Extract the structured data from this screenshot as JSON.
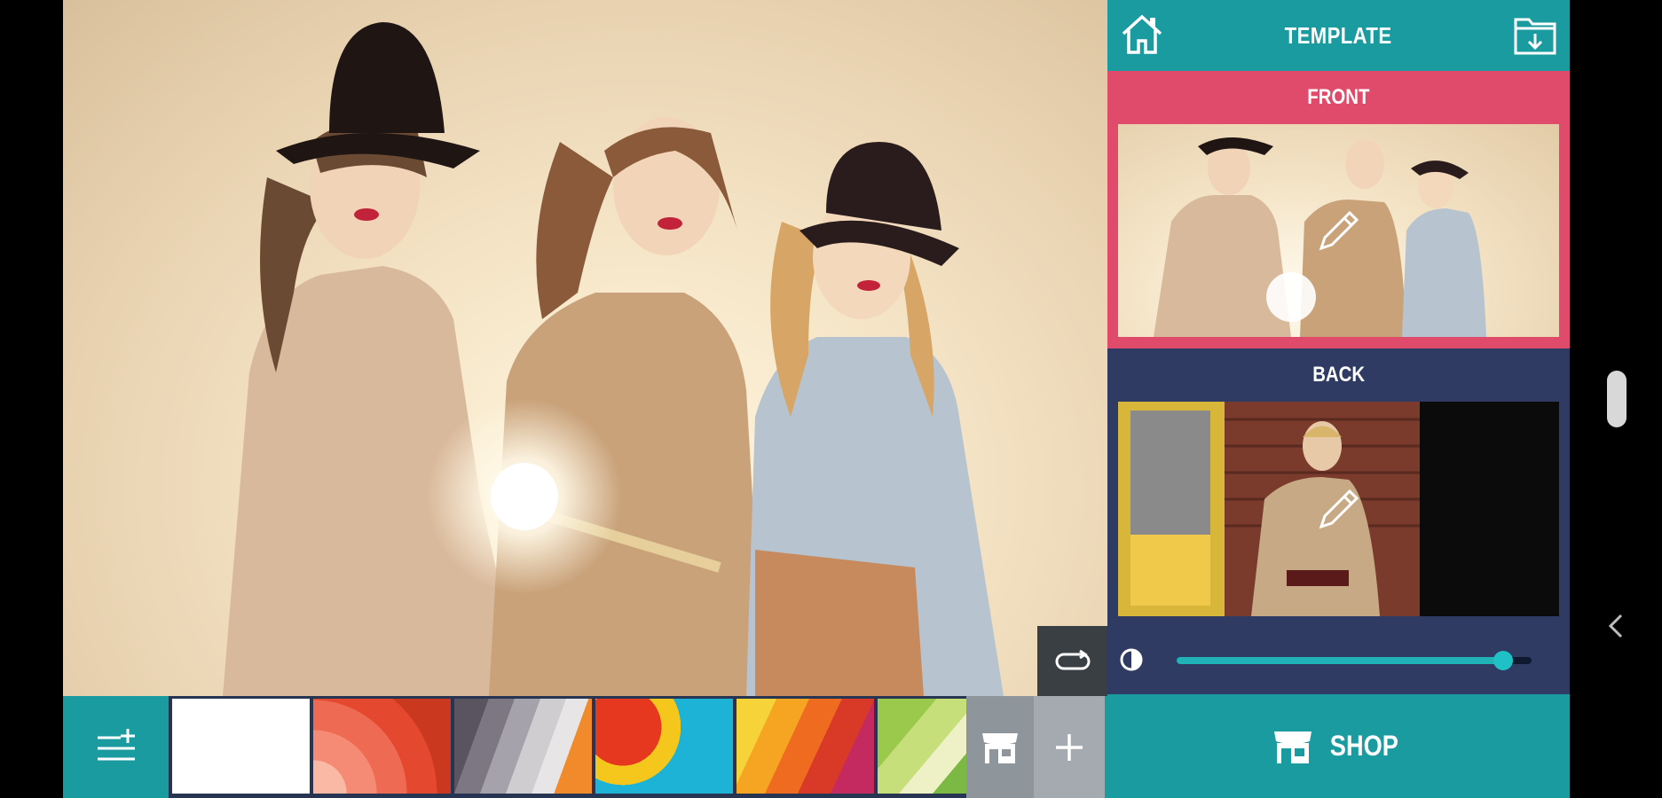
{
  "header": {
    "title": "TEMPLATE",
    "home_icon": "home-icon",
    "save_icon": "folder-download-icon"
  },
  "front": {
    "label": "FRONT"
  },
  "back": {
    "label": "BACK"
  },
  "opacity": {
    "icon": "contrast-icon",
    "value": 0.92
  },
  "shop": {
    "label": "SHOP",
    "icon": "store-icon"
  },
  "bottom_bar": {
    "layers_icon": "layers-add-icon",
    "backgrounds": [
      "white",
      "coral-rings",
      "gray-stripes",
      "retro-circles",
      "warm-stripes",
      "green-chevrons"
    ],
    "store_icon": "store-icon",
    "add_icon": "plus-icon"
  },
  "colors": {
    "teal": "#1a9ba0",
    "navy": "#2f3b63",
    "pink": "#e04a6b"
  }
}
